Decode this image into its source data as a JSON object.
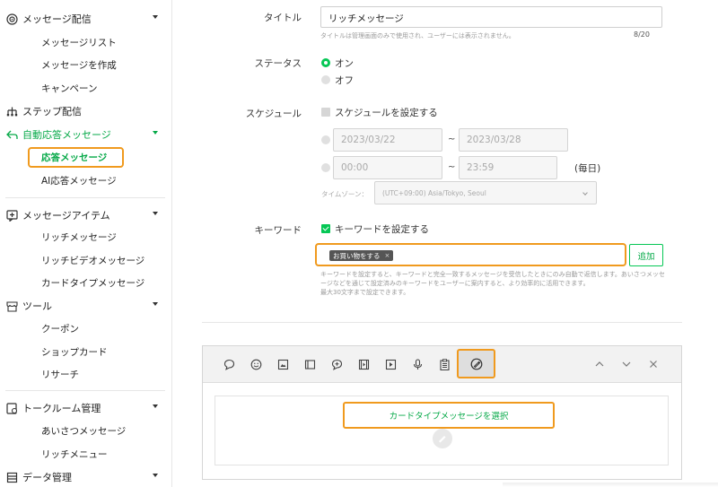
{
  "sidebar": {
    "sections": [
      {
        "label": "メッセージ配信",
        "icon": "broadcast-icon",
        "items": [
          "メッセージリスト",
          "メッセージを作成",
          "キャンペーン"
        ]
      },
      {
        "label": "ステップ配信",
        "icon": "hierarchy-icon",
        "items": []
      },
      {
        "label": "自動応答メッセージ",
        "icon": "reply-icon",
        "items": [
          "応答メッセージ",
          "AI応答メッセージ"
        ]
      },
      {
        "label": "メッセージアイテム",
        "icon": "message-item-icon",
        "items": [
          "リッチメッセージ",
          "リッチビデオメッセージ",
          "カードタイプメッセージ"
        ]
      },
      {
        "label": "ツール",
        "icon": "store-icon",
        "items": [
          "クーポン",
          "ショップカード",
          "リサーチ"
        ]
      },
      {
        "label": "トークルーム管理",
        "icon": "chat-settings-icon",
        "items": [
          "あいさつメッセージ",
          "リッチメニュー"
        ]
      },
      {
        "label": "データ管理",
        "icon": "data-icon",
        "items": []
      }
    ]
  },
  "form": {
    "title_label": "タイトル",
    "title_value": "リッチメッセージ",
    "title_hint": "タイトルは管理画面のみで使用され、ユーザーには表示されません。",
    "title_counter": "8/20",
    "status_label": "ステータス",
    "status_on": "オン",
    "status_off": "オフ",
    "schedule_label": "スケジュール",
    "schedule_check": "スケジュールを設定する",
    "date_from": "2023/03/22",
    "date_to": "2023/03/28",
    "time_from": "00:00",
    "time_to": "23:59",
    "tilde": "~",
    "daily": "(毎日)",
    "tz_label": "タイムゾーン：",
    "tz_value": "(UTC+09:00) Asia/Tokyo, Seoul",
    "keyword_label": "キーワード",
    "keyword_check": "キーワードを設定する",
    "keyword_tag": "お買い物をする",
    "keyword_tag_remove": "×",
    "add_button": "追加",
    "keyword_hint": "キーワードを設定すると、キーワードと完全一致するメッセージを受信したときにのみ自動で返信します。あいさつメッセージなどを通じて設定済みのキーワードをユーザーに案内すると、より効率的に活用できます。",
    "keyword_limit": "最大30文字まで設定できます。"
  },
  "editor": {
    "toolbar_icons": [
      "text-bubble-icon",
      "emoji-icon",
      "image-icon",
      "card-icon",
      "coupon-icon",
      "video-frame-icon",
      "play-icon",
      "mic-icon",
      "clipboard-icon",
      "card-type-icon"
    ],
    "select_button": "カードタイプメッセージを選択"
  },
  "colors": {
    "accent": "#06c755",
    "highlight": "#f09a1e"
  }
}
